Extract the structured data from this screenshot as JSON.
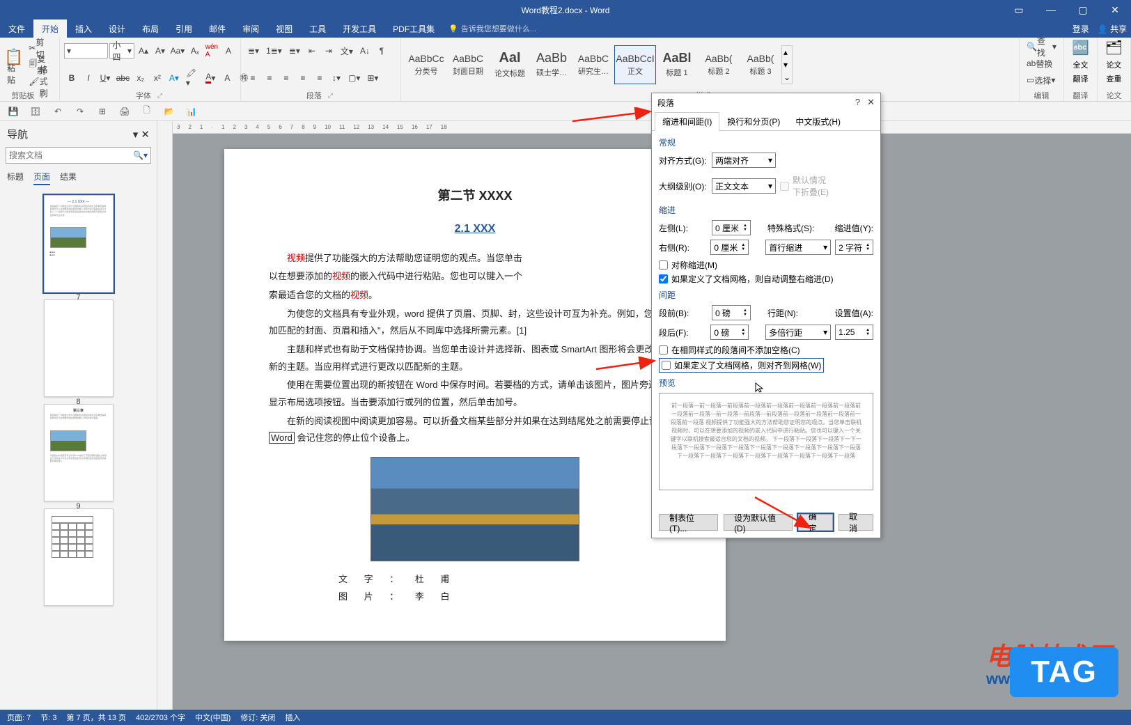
{
  "window": {
    "title": "Word教程2.docx - Word"
  },
  "tabs": {
    "file": "文件",
    "home": "开始",
    "insert": "插入",
    "design": "设计",
    "layout": "布局",
    "references": "引用",
    "mailings": "邮件",
    "review": "审阅",
    "view": "视图",
    "tools": "工具",
    "developer": "开发工具",
    "pdf": "PDF工具集",
    "tell": "告诉我您想要做什么...",
    "login": "登录",
    "share": "共享"
  },
  "ribbon": {
    "clipboard": {
      "label": "剪贴板",
      "cut": "剪切",
      "copy": "复制",
      "formatpainter": "格式刷",
      "paste": "粘贴"
    },
    "font": {
      "label": "字体",
      "name": "",
      "size": "小四"
    },
    "paragraph": {
      "label": "段落"
    },
    "styles": {
      "label": "样式",
      "items": [
        {
          "preview": "AaBbCc",
          "name": "分类号"
        },
        {
          "preview": "AaBbC",
          "name": "封面日期"
        },
        {
          "preview": "AaI",
          "name": "论文标题"
        },
        {
          "preview": "AaBb",
          "name": "硕士学…"
        },
        {
          "preview": "AaBbC",
          "name": "研究生…"
        },
        {
          "preview": "AaBbCcI",
          "name": "正文",
          "sel": true
        },
        {
          "preview": "AaBl",
          "name": "标题 1"
        },
        {
          "preview": "AaBb(",
          "name": "标题 2"
        },
        {
          "preview": "AaBb(",
          "name": "标题 3"
        }
      ]
    },
    "editing": {
      "label": "编辑",
      "find": "查找",
      "replace": "替换",
      "select": "选择"
    },
    "translate": {
      "label": "翻译",
      "full": "全文",
      "trans": "翻译"
    },
    "dupcheck": {
      "label": "论文",
      "a": "论文",
      "b": "查重"
    }
  },
  "nav": {
    "title": "导航",
    "search_placeholder": "搜索文档",
    "tabs": {
      "headings": "标题",
      "pages": "页面",
      "results": "结果"
    },
    "thumbs": [
      {
        "n": "7"
      },
      {
        "n": "8"
      },
      {
        "n": "9"
      },
      {
        "n": ""
      }
    ]
  },
  "document": {
    "h2": "第二节  XXXX",
    "h3": "2.1 XXX",
    "p1a": "视频",
    "p1b": "提供了功能强大的方法帮助您证明您的观点。当您单击",
    "p1c": "以在想要添加的",
    "p1d": "视频",
    "p1e": "的嵌入代码中进行粘贴。您也可以键入一个",
    "p1f": "索最适合您的文档的",
    "p1g": "视频",
    "p1h": "。",
    "p2": "为使您的文档具有专业外观，word 提供了页眉、页脚、封，这些设计可互为补充。例如，您可以添加匹配的封面、页眉和插入\"，然后从不同库中选择所需元素。[1]",
    "p3": "主题和样式也有助于文档保持协调。当您单击设计并选择新、图表或 SmartArt 图形将会更改以匹配新的主题。当应用样式进行更改以匹配新的主题。",
    "p4": "使用在需要位置出现的新按钮在 Word 中保存时间。若要档的方式，请单击该图片，图片旁边将会显示布局选项按钮。当击要添加行或列的位置，然后单击加号。",
    "p5a": "在新的阅读视图中阅读更加容易。可以折叠文档某些部分并如果在达到结尾处之前需要停止读取，",
    "p5b": "Word",
    "p5c": " 会记住您的停止位个设备上。",
    "credits": [
      "文 字 ：  杜     甫",
      "图 片 ：  李     白"
    ]
  },
  "dialog": {
    "title": "段落",
    "tabs": {
      "t1": "缩进和间距(I)",
      "t2": "换行和分页(P)",
      "t3": "中文版式(H)"
    },
    "general": {
      "label": "常规",
      "align_l": "对齐方式(G):",
      "align_v": "两端对齐",
      "outline_l": "大纲级别(O):",
      "outline_v": "正文文本",
      "collapse": "默认情况下折叠(E)"
    },
    "indent": {
      "label": "缩进",
      "left_l": "左侧(L):",
      "left_v": "0 厘米",
      "right_l": "右侧(R):",
      "right_v": "0 厘米",
      "special_l": "特殊格式(S):",
      "special_v": "首行缩进",
      "by_l": "缩进值(Y):",
      "by_v": "2 字符",
      "mirror": "对称缩进(M)",
      "grid": "如果定义了文档网格，则自动调整右缩进(D)"
    },
    "spacing": {
      "label": "间距",
      "before_l": "段前(B):",
      "before_v": "0 磅",
      "after_l": "段后(F):",
      "after_v": "0 磅",
      "line_l": "行距(N):",
      "line_v": "多倍行距",
      "at_l": "设置值(A):",
      "at_v": "1.25",
      "noextra": "在相同样式的段落间不添加空格(C)",
      "snap": "如果定义了文档网格，则对齐到网格(W)"
    },
    "preview": "预览",
    "preview_text": "前一段落—前一段落—前段落前—段落前—段落前—段落前一段落前一段落前一段落前一段落—前一段落—前段落—前段落前—段落前一段落前一段落前一段落前一段落\n视频提供了功能强大的方法帮助您证明您的观点。当您单击联机视频时，可以在想要添加的视频的嵌入代码中进行粘贴。您也可以键入一个关键字以联机搜索最适合您的文档的视频。\n下一段落下一段落下一段落下一下一段落下一段落下一段落下一段落下一段落下一段落下一段落下一段落下一段落下一段落下一段落下一段落下一段落下一段落下一段落下一段落下一段落",
    "btn_tabs": "制表位(T)...",
    "btn_default": "设为默认值(D)",
    "btn_ok": "确定",
    "btn_cancel": "取消"
  },
  "status": {
    "page": "页面: 7",
    "section": "节: 3",
    "pageof": "第 7 页，共 13 页",
    "words": "402/2703 个字",
    "lang": "中文(中国)",
    "track": "修订: 关闭",
    "insert": "插入"
  },
  "watermark": {
    "name": "电脑技术网",
    "url": "www.tagxp.com",
    "tag": "TAG"
  }
}
